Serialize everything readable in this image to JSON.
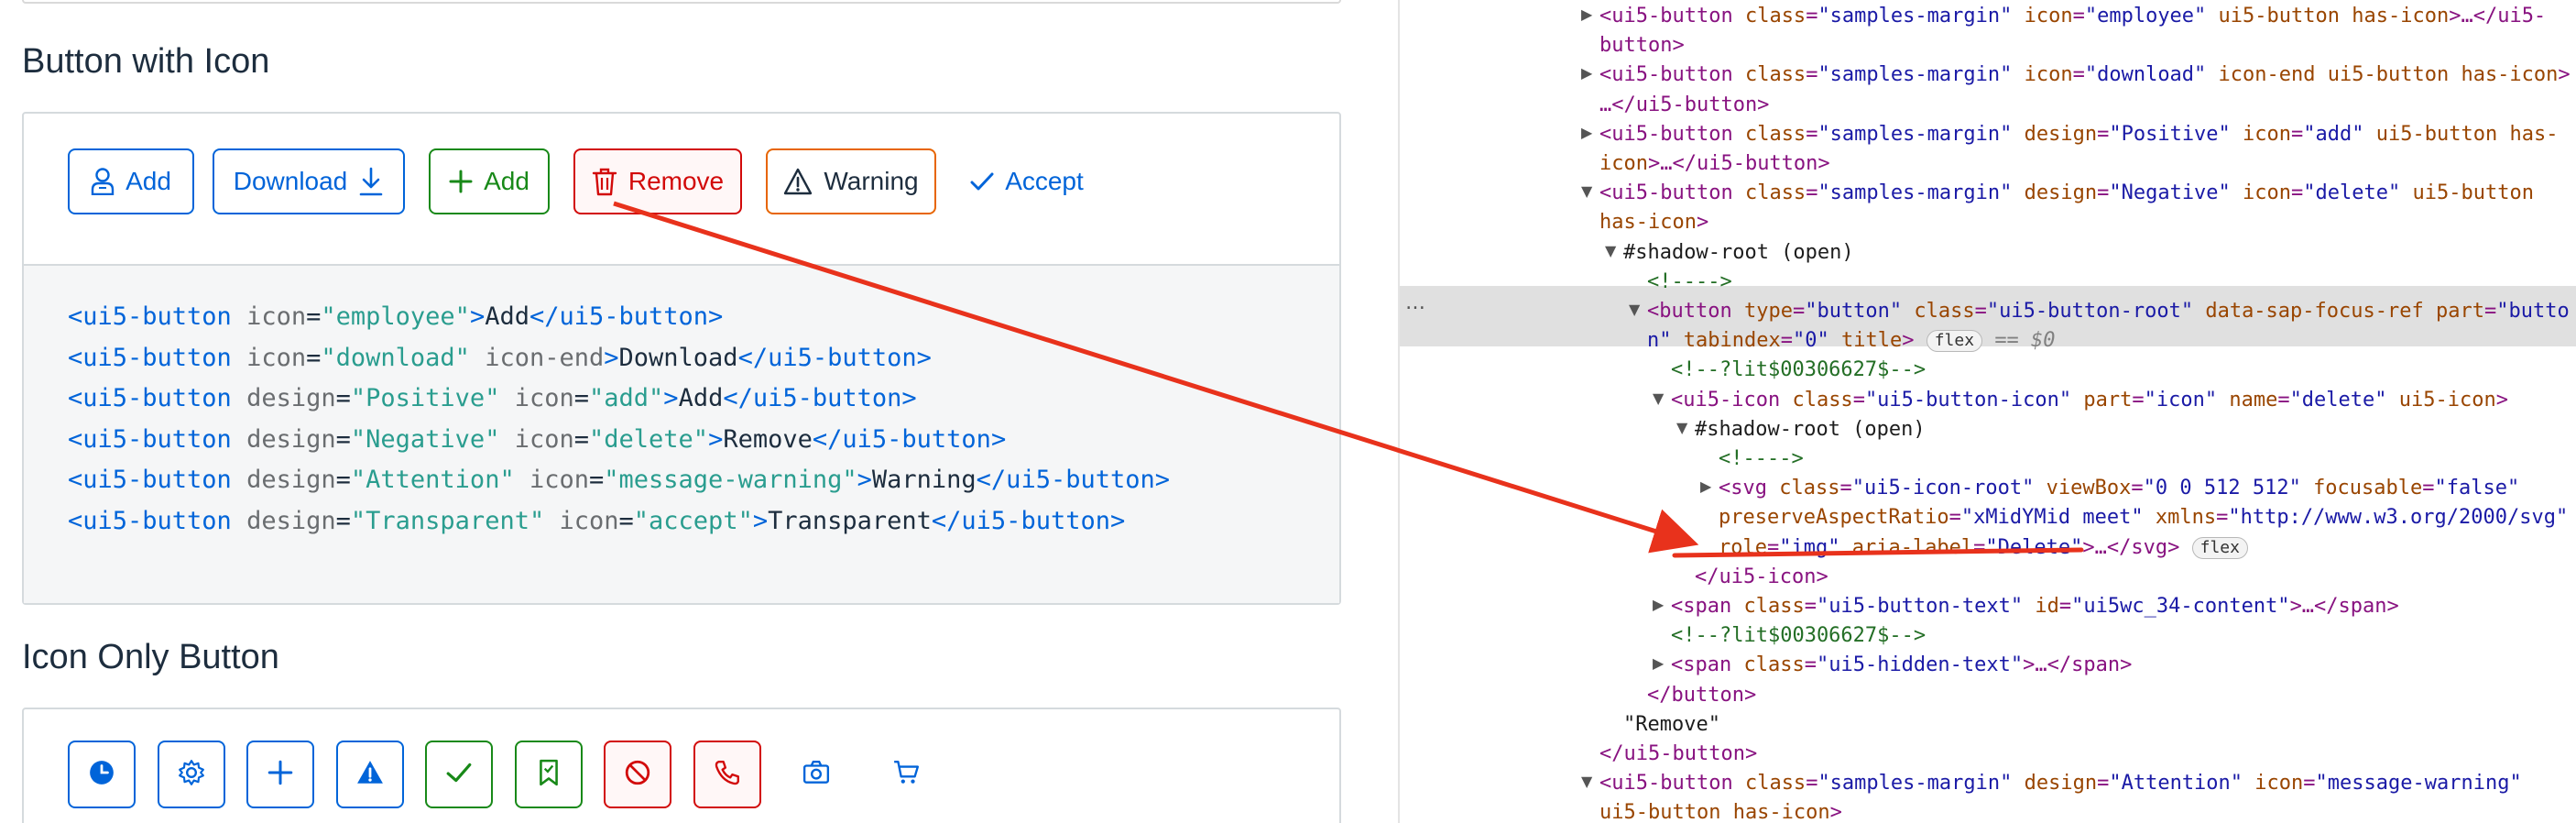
{
  "sections": {
    "button_with_icon": "Button with Icon",
    "icon_only_button": "Icon Only Button"
  },
  "buttons": [
    {
      "label": "Add",
      "icon": "employee-icon",
      "design": "Default"
    },
    {
      "label": "Download",
      "icon": "download-icon",
      "design": "Default"
    },
    {
      "label": "Add",
      "icon": "add-icon",
      "design": "Positive"
    },
    {
      "label": "Remove",
      "icon": "delete-icon",
      "design": "Negative"
    },
    {
      "label": "Warning",
      "icon": "message-warning-icon",
      "design": "Attention"
    },
    {
      "label": "Accept",
      "icon": "accept-icon",
      "design": "Transparent"
    }
  ],
  "code_lines": [
    {
      "open": "<ui5-button",
      "attrs": [
        {
          "n": "icon",
          "v": "\"employee\""
        }
      ],
      "close": ">",
      "text": "Add",
      "end": "</ui5-button>"
    },
    {
      "open": "<ui5-button",
      "attrs": [
        {
          "n": "icon",
          "v": "\"download\""
        },
        {
          "n": "icon-end",
          "v": ""
        }
      ],
      "close": ">",
      "text": "Download",
      "end": "</ui5-button>"
    },
    {
      "open": "<ui5-button",
      "attrs": [
        {
          "n": "design",
          "v": "\"Positive\""
        },
        {
          "n": "icon",
          "v": "\"add\""
        }
      ],
      "close": ">",
      "text": "Add",
      "end": "</ui5-button>"
    },
    {
      "open": "<ui5-button",
      "attrs": [
        {
          "n": "design",
          "v": "\"Negative\""
        },
        {
          "n": "icon",
          "v": "\"delete\""
        }
      ],
      "close": ">",
      "text": "Remove",
      "end": "</ui5-button>"
    },
    {
      "open": "<ui5-button",
      "attrs": [
        {
          "n": "design",
          "v": "\"Attention\""
        },
        {
          "n": "icon",
          "v": "\"message-warning\""
        }
      ],
      "close": ">",
      "text": "Warning",
      "end": "</ui5-button>"
    },
    {
      "open": "<ui5-button",
      "attrs": [
        {
          "n": "design",
          "v": "\"Transparent\""
        },
        {
          "n": "icon",
          "v": "\"accept\""
        }
      ],
      "close": ">",
      "text": "Transparent",
      "end": "</ui5-button>"
    }
  ],
  "icon_only_buttons": [
    {
      "icon": "history-icon",
      "design": "Emphasized"
    },
    {
      "icon": "settings-icon",
      "design": "Default"
    },
    {
      "icon": "add-icon",
      "design": "Default"
    },
    {
      "icon": "warning-icon",
      "design": "Emphasized"
    },
    {
      "icon": "accept-icon",
      "design": "Positive"
    },
    {
      "icon": "bookmark-icon",
      "design": "Positive"
    },
    {
      "icon": "decline-icon",
      "design": "Negative"
    },
    {
      "icon": "call-icon",
      "design": "Negative"
    },
    {
      "icon": "camera-icon",
      "design": "Transparent"
    },
    {
      "icon": "cart-icon",
      "design": "Transparent"
    }
  ],
  "devtools": {
    "lines": [
      {
        "indent": 0,
        "tri": "right",
        "segs": [
          [
            "t",
            "<ui5-button "
          ],
          [
            "an",
            "class"
          ],
          [
            "t",
            "="
          ],
          [
            "av",
            "\"samples-margin\""
          ],
          [
            "t",
            " "
          ],
          [
            "an",
            "icon"
          ],
          [
            "t",
            "="
          ],
          [
            "av",
            "\"employee\""
          ],
          [
            "t",
            " "
          ],
          [
            "an",
            "ui5-button has-icon"
          ],
          [
            "t",
            ">…</ui5-"
          ]
        ]
      },
      {
        "indent": 0,
        "tri": "",
        "segs": [
          [
            "t",
            "button>"
          ]
        ]
      },
      {
        "indent": 0,
        "tri": "right",
        "segs": [
          [
            "t",
            "<ui5-button "
          ],
          [
            "an",
            "class"
          ],
          [
            "t",
            "="
          ],
          [
            "av",
            "\"samples-margin\""
          ],
          [
            "t",
            " "
          ],
          [
            "an",
            "icon"
          ],
          [
            "t",
            "="
          ],
          [
            "av",
            "\"download\""
          ],
          [
            "t",
            " "
          ],
          [
            "an",
            "icon-end ui5-button has-icon"
          ],
          [
            "t",
            ">"
          ]
        ]
      },
      {
        "indent": 0,
        "tri": "",
        "segs": [
          [
            "t",
            "…</ui5-button>"
          ]
        ]
      },
      {
        "indent": 0,
        "tri": "right",
        "segs": [
          [
            "t",
            "<ui5-button "
          ],
          [
            "an",
            "class"
          ],
          [
            "t",
            "="
          ],
          [
            "av",
            "\"samples-margin\""
          ],
          [
            "t",
            " "
          ],
          [
            "an",
            "design"
          ],
          [
            "t",
            "="
          ],
          [
            "av",
            "\"Positive\""
          ],
          [
            "t",
            " "
          ],
          [
            "an",
            "icon"
          ],
          [
            "t",
            "="
          ],
          [
            "av",
            "\"add\""
          ],
          [
            "t",
            " "
          ],
          [
            "an",
            "ui5-button has-"
          ]
        ]
      },
      {
        "indent": 0,
        "tri": "",
        "segs": [
          [
            "an",
            "icon"
          ],
          [
            "t",
            ">…</ui5-button>"
          ]
        ]
      },
      {
        "indent": 0,
        "tri": "down",
        "segs": [
          [
            "t",
            "<ui5-button "
          ],
          [
            "an",
            "class"
          ],
          [
            "t",
            "="
          ],
          [
            "av",
            "\"samples-margin\""
          ],
          [
            "t",
            " "
          ],
          [
            "an",
            "design"
          ],
          [
            "t",
            "="
          ],
          [
            "av",
            "\"Negative\""
          ],
          [
            "t",
            " "
          ],
          [
            "an",
            "icon"
          ],
          [
            "t",
            "="
          ],
          [
            "av",
            "\"delete\""
          ],
          [
            "t",
            " "
          ],
          [
            "an",
            "ui5-button"
          ]
        ]
      },
      {
        "indent": 0,
        "tri": "",
        "segs": [
          [
            "an",
            "has-icon"
          ],
          [
            "t",
            ">"
          ]
        ]
      },
      {
        "indent": 1,
        "tri": "down",
        "segs": [
          [
            "sr",
            "#shadow-root (open)"
          ]
        ]
      },
      {
        "indent": 2,
        "tri": "",
        "segs": [
          [
            "cm",
            "<!---->"
          ]
        ]
      },
      {
        "indent": 2,
        "tri": "down",
        "segs": [
          [
            "t",
            "<button "
          ],
          [
            "an",
            "type"
          ],
          [
            "t",
            "="
          ],
          [
            "av",
            "\"button\""
          ],
          [
            "t",
            " "
          ],
          [
            "an",
            "class"
          ],
          [
            "t",
            "="
          ],
          [
            "av",
            "\"ui5-button-root\""
          ],
          [
            "t",
            " "
          ],
          [
            "an",
            "data-sap-focus-ref"
          ],
          [
            "t",
            " "
          ],
          [
            "an",
            "part"
          ],
          [
            "t",
            "="
          ],
          [
            "av",
            "\"butto"
          ]
        ]
      },
      {
        "indent": 2,
        "tri": "",
        "segs": [
          [
            "av",
            "n\""
          ],
          [
            "t",
            " "
          ],
          [
            "an",
            "tabindex"
          ],
          [
            "t",
            "="
          ],
          [
            "av",
            "\"0\""
          ],
          [
            "t",
            " "
          ],
          [
            "an",
            "title"
          ],
          [
            "t",
            ">"
          ]
        ],
        "badge": "flex",
        "eq": "== $0"
      },
      {
        "indent": 3,
        "tri": "",
        "segs": [
          [
            "cm",
            "<!--?lit$00306627$-->"
          ]
        ]
      },
      {
        "indent": 3,
        "tri": "down",
        "segs": [
          [
            "t",
            "<ui5-icon "
          ],
          [
            "an",
            "class"
          ],
          [
            "t",
            "="
          ],
          [
            "av",
            "\"ui5-button-icon\""
          ],
          [
            "t",
            " "
          ],
          [
            "an",
            "part"
          ],
          [
            "t",
            "="
          ],
          [
            "av",
            "\"icon\""
          ],
          [
            "t",
            " "
          ],
          [
            "an",
            "name"
          ],
          [
            "t",
            "="
          ],
          [
            "av",
            "\"delete\""
          ],
          [
            "t",
            " "
          ],
          [
            "an",
            "ui5-icon"
          ],
          [
            "t",
            ">"
          ]
        ]
      },
      {
        "indent": 4,
        "tri": "down",
        "segs": [
          [
            "sr",
            "#shadow-root (open)"
          ]
        ]
      },
      {
        "indent": 5,
        "tri": "",
        "segs": [
          [
            "cm",
            "<!---->"
          ]
        ]
      },
      {
        "indent": 5,
        "tri": "right",
        "segs": [
          [
            "t",
            "<svg "
          ],
          [
            "an",
            "class"
          ],
          [
            "t",
            "="
          ],
          [
            "av",
            "\"ui5-icon-root\""
          ],
          [
            "t",
            " "
          ],
          [
            "an",
            "viewBox"
          ],
          [
            "t",
            "="
          ],
          [
            "av",
            "\"0 0 512 512\""
          ],
          [
            "t",
            " "
          ],
          [
            "an",
            "focusable"
          ],
          [
            "t",
            "="
          ],
          [
            "av",
            "\"false\""
          ]
        ]
      },
      {
        "indent": 5,
        "tri": "",
        "segs": [
          [
            "an",
            "preserveAspectRatio"
          ],
          [
            "t",
            "="
          ],
          [
            "av",
            "\"xMidYMid meet\""
          ],
          [
            "t",
            " "
          ],
          [
            "an",
            "xmlns"
          ],
          [
            "t",
            "="
          ],
          [
            "av",
            "\"http://www.w3.org/2000/svg\""
          ]
        ]
      },
      {
        "indent": 5,
        "tri": "",
        "segs": [
          [
            "an",
            "role"
          ],
          [
            "t",
            "="
          ],
          [
            "av",
            "\"img\""
          ],
          [
            "t",
            " "
          ],
          [
            "an",
            "aria-label"
          ],
          [
            "t",
            "="
          ],
          [
            "av",
            "\"Delete\""
          ],
          [
            "t",
            ">…</svg>"
          ]
        ],
        "badge": "flex"
      },
      {
        "indent": 4,
        "tri": "",
        "segs": [
          [
            "t",
            "</ui5-icon>"
          ]
        ]
      },
      {
        "indent": 3,
        "tri": "right",
        "segs": [
          [
            "t",
            "<span "
          ],
          [
            "an",
            "class"
          ],
          [
            "t",
            "="
          ],
          [
            "av",
            "\"ui5-button-text\""
          ],
          [
            "t",
            " "
          ],
          [
            "an",
            "id"
          ],
          [
            "t",
            "="
          ],
          [
            "av",
            "\"ui5wc_34-content\""
          ],
          [
            "t",
            ">…</span>"
          ]
        ]
      },
      {
        "indent": 3,
        "tri": "",
        "segs": [
          [
            "cm",
            "<!--?lit$00306627$-->"
          ]
        ]
      },
      {
        "indent": 3,
        "tri": "right",
        "segs": [
          [
            "t",
            "<span "
          ],
          [
            "an",
            "class"
          ],
          [
            "t",
            "="
          ],
          [
            "av",
            "\"ui5-hidden-text\""
          ],
          [
            "t",
            ">…</span>"
          ]
        ]
      },
      {
        "indent": 2,
        "tri": "",
        "segs": [
          [
            "t",
            "</button>"
          ]
        ]
      },
      {
        "indent": 1,
        "tri": "",
        "segs": [
          [
            "sr",
            "\"Remove\""
          ]
        ]
      },
      {
        "indent": 0,
        "tri": "",
        "segs": [
          [
            "t",
            "</ui5-button>"
          ]
        ]
      },
      {
        "indent": 0,
        "tri": "down",
        "segs": [
          [
            "t",
            "<ui5-button "
          ],
          [
            "an",
            "class"
          ],
          [
            "t",
            "="
          ],
          [
            "av",
            "\"samples-margin\""
          ],
          [
            "t",
            " "
          ],
          [
            "an",
            "design"
          ],
          [
            "t",
            "="
          ],
          [
            "av",
            "\"Attention\""
          ],
          [
            "t",
            " "
          ],
          [
            "an",
            "icon"
          ],
          [
            "t",
            "="
          ],
          [
            "av",
            "\"message-warning\""
          ]
        ]
      },
      {
        "indent": 0,
        "tri": "",
        "segs": [
          [
            "an",
            "ui5-button has-icon"
          ],
          [
            "t",
            ">"
          ]
        ]
      }
    ],
    "more_dots": "…"
  },
  "colors": {
    "accent_blue": "#0064d9",
    "positive": "#188918",
    "negative": "#d20a0a",
    "attention": "#e76500",
    "annotation_red": "#e8321c"
  }
}
